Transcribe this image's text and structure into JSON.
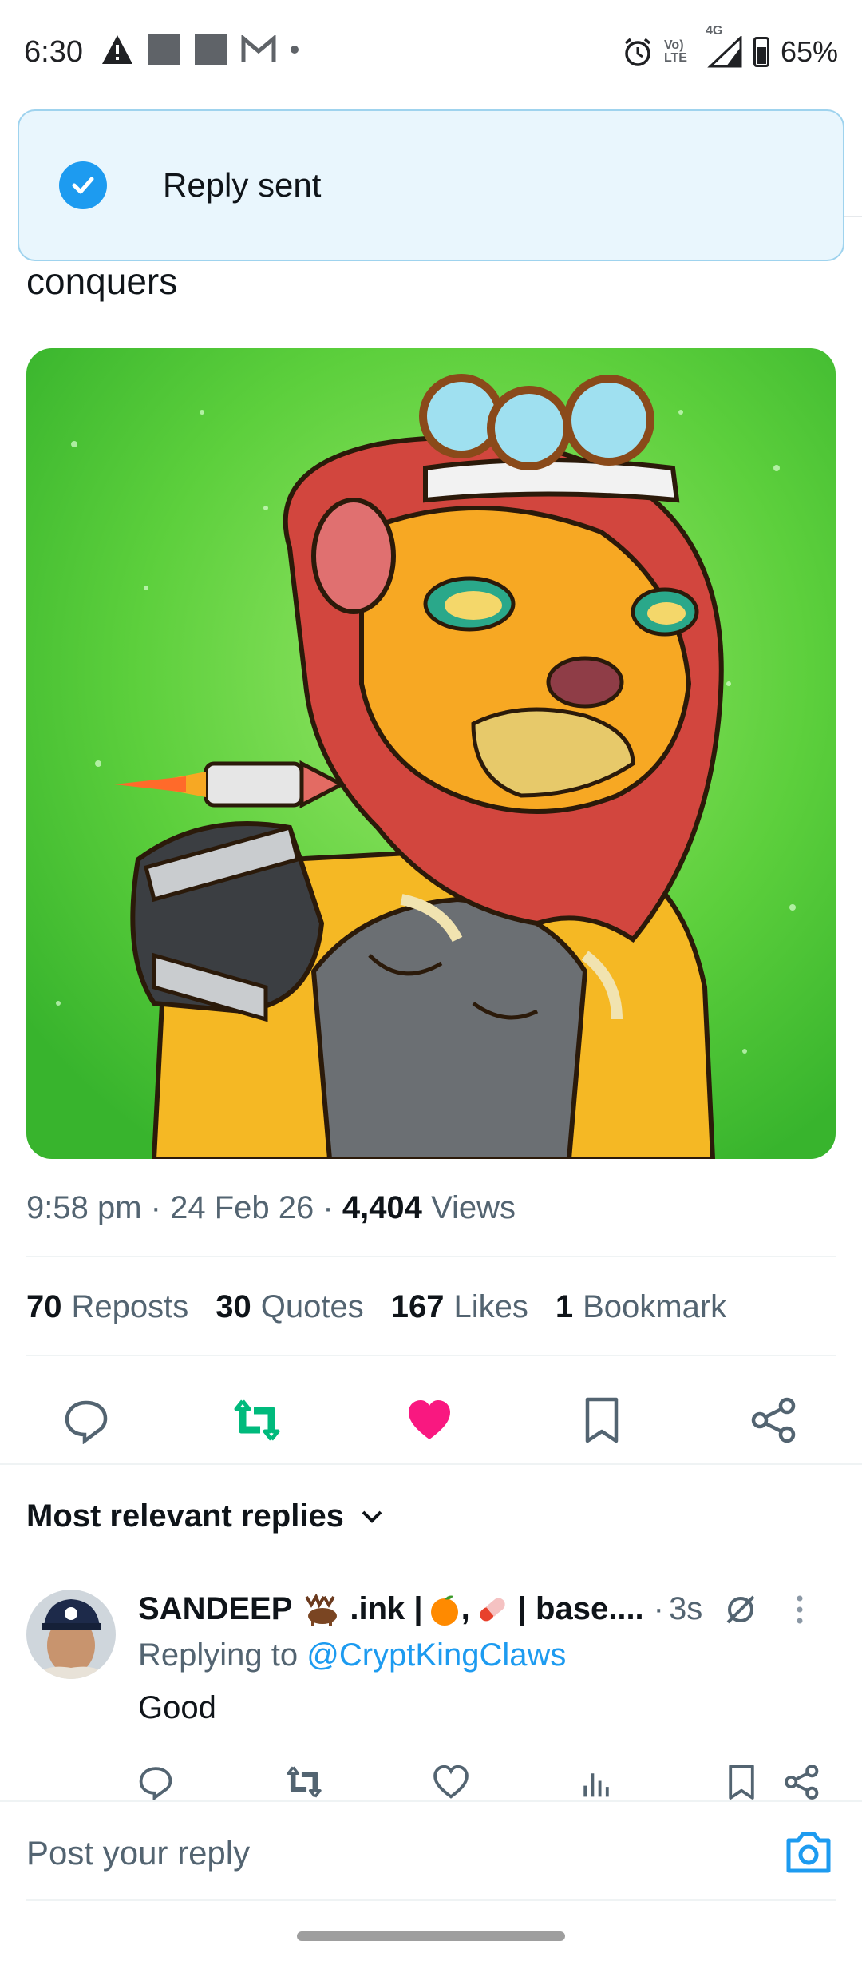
{
  "status_bar": {
    "time": "6:30",
    "network_label": "4G",
    "volte_label": "Vo) LTE",
    "battery": "65%"
  },
  "toast": {
    "message": "Reply sent",
    "icon": "check-circle-icon",
    "color": "#1d9bf0"
  },
  "tweet": {
    "text_tail": "conquers",
    "time": "9:58 pm",
    "date": "24 Feb 26",
    "views_count": "4,404",
    "views_label": "Views",
    "sep": "·"
  },
  "stats": [
    {
      "count": "70",
      "label": "Reposts"
    },
    {
      "count": "30",
      "label": "Quotes"
    },
    {
      "count": "167",
      "label": "Likes"
    },
    {
      "count": "1",
      "label": "Bookmark"
    }
  ],
  "actions": {
    "icons": [
      "reply-icon",
      "repost-icon",
      "like-icon",
      "bookmark-icon",
      "share-icon"
    ],
    "repost_color": "#00ba7c",
    "like_color": "#f91880"
  },
  "replies_sort": {
    "label": "Most relevant replies"
  },
  "reply": {
    "name": "SANDEEP",
    "name_suffix": ".ink |",
    "name_suffix2": ",",
    "name_suffix3": "| base....",
    "time_sep": "·",
    "time": "3s",
    "replying_prefix": "Replying to",
    "replying_handle": "@CryptKingClaws",
    "text": "Good"
  },
  "composer": {
    "placeholder": "Post your reply"
  }
}
